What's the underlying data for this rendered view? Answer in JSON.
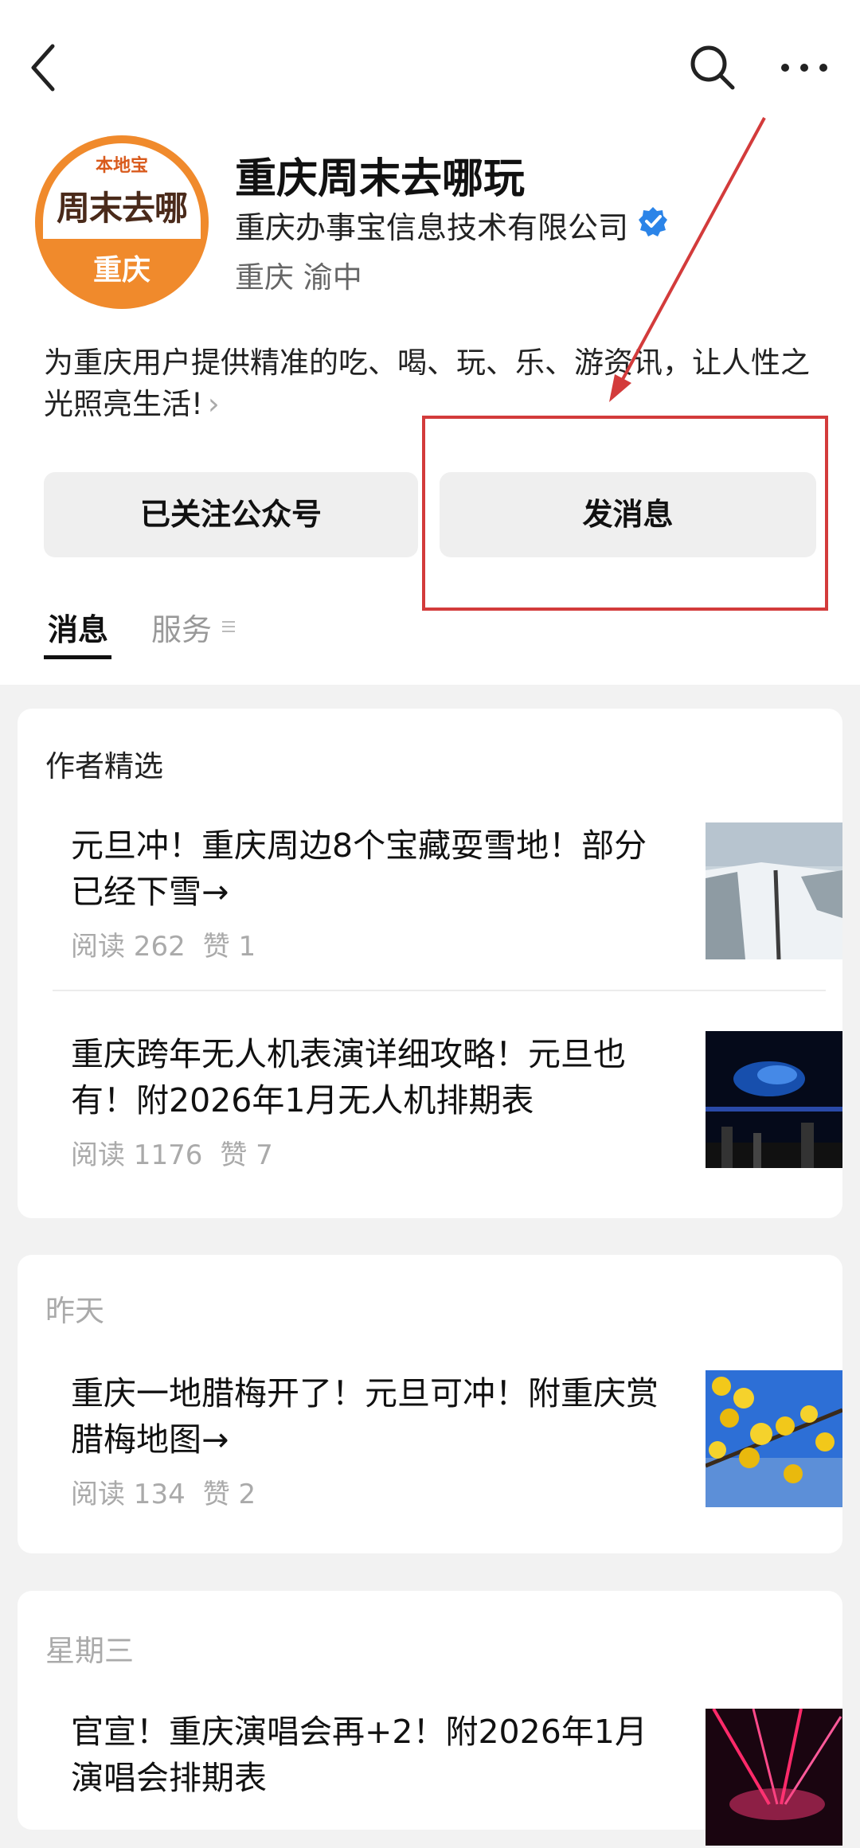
{
  "account": {
    "name": "重庆周末去哪玩",
    "company": "重庆办事宝信息技术有限公司",
    "location": "重庆 渝中",
    "description": "为重庆用户提供精准的吃、喝、玩、乐、游资讯，让人性之光照亮生活!",
    "logo": {
      "top_text": "本地宝",
      "main_text": "周末去哪",
      "city": "重庆"
    }
  },
  "buttons": {
    "follow": "已关注公众号",
    "message": "发消息"
  },
  "tabs": {
    "messages": "消息",
    "services": "服务"
  },
  "sections": [
    {
      "title": "作者精选",
      "articles": [
        {
          "title": "元旦冲！重庆周边8个宝藏耍雪地！部分已经下雪→",
          "reads": "阅读 262",
          "likes": "赞 1"
        },
        {
          "title": "重庆跨年无人机表演详细攻略！元旦也有！附2026年1月无人机排期表",
          "reads": "阅读 1176",
          "likes": "赞 7"
        }
      ]
    },
    {
      "title": "昨天",
      "articles": [
        {
          "title": "重庆一地腊梅开了！元旦可冲！附重庆赏腊梅地图→",
          "reads": "阅读 134",
          "likes": "赞 2"
        }
      ]
    },
    {
      "title": "星期三",
      "articles": [
        {
          "title": "官宣！重庆演唱会再+2！附2026年1月演唱会排期表"
        }
      ]
    }
  ],
  "colors": {
    "accent": "#f08a2c",
    "verified": "#2b84e8",
    "annotation": "#d33b3b"
  }
}
